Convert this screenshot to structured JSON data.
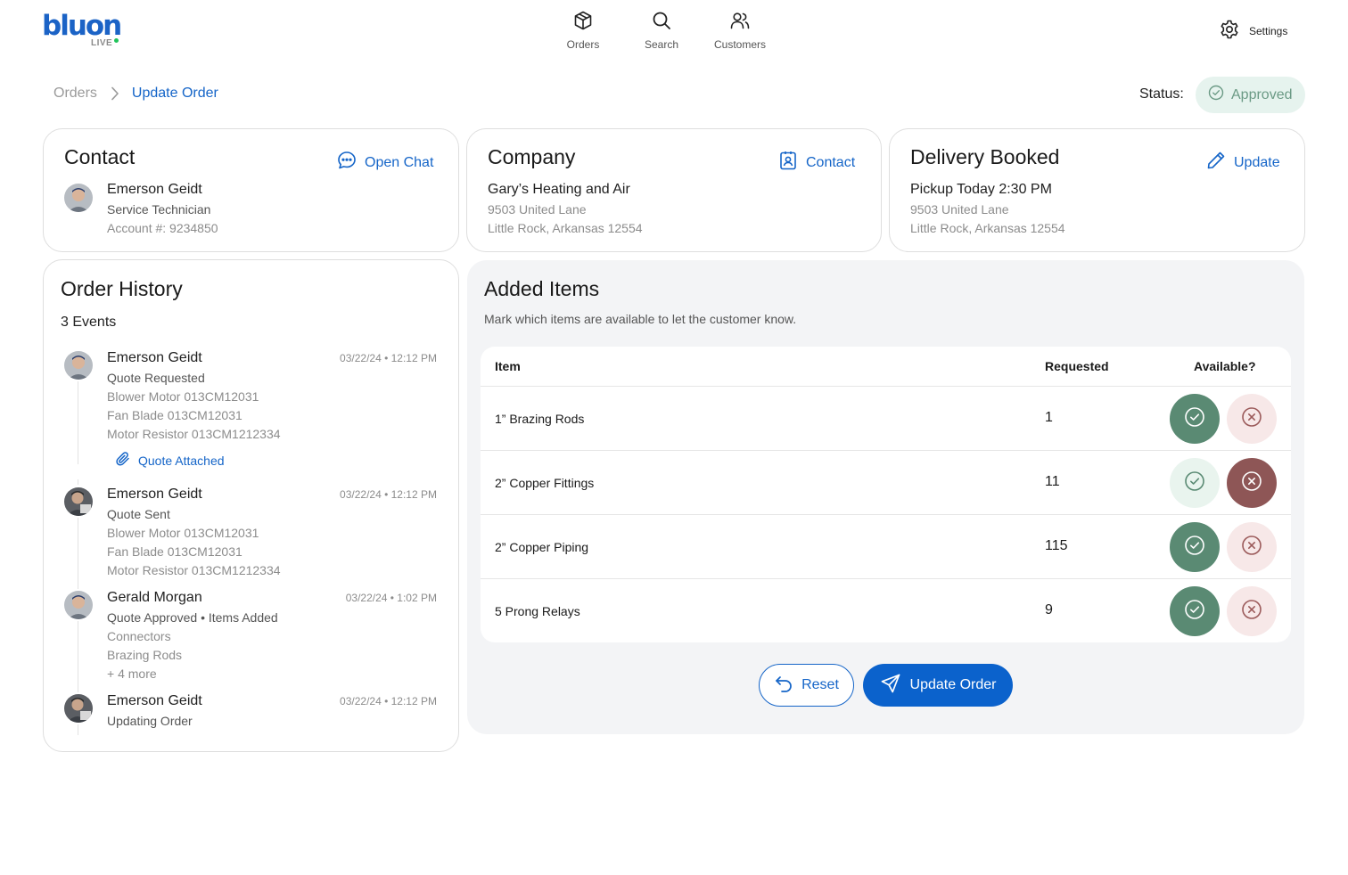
{
  "brand": {
    "logo_text": "bluon",
    "logo_sub": "LIVE"
  },
  "nav": {
    "orders": "Orders",
    "search": "Search",
    "customers": "Customers",
    "settings": "Settings"
  },
  "breadcrumb": {
    "parent": "Orders",
    "current": "Update Order"
  },
  "status": {
    "label": "Status:",
    "value": "Approved"
  },
  "contact_card": {
    "title": "Contact",
    "action": "Open Chat",
    "name": "Emerson Geidt",
    "role": "Service Technician",
    "account": "Account #: 9234850"
  },
  "company_card": {
    "title": "Company",
    "action": "Contact",
    "name": "Gary’s Heating and Air",
    "address1": "9503 United Lane",
    "address2": "Little Rock, Arkansas 12554"
  },
  "delivery_card": {
    "title": "Delivery Booked",
    "action": "Update",
    "pickup": "Pickup Today 2:30 PM",
    "address1": "9503 United Lane",
    "address2": "Little Rock, Arkansas 12554"
  },
  "history": {
    "title": "Order History",
    "count": "3 Events",
    "events": [
      {
        "name": "Emerson Geidt",
        "time": "03/22/24 • 12:12 PM",
        "action": "Quote Requested",
        "items": [
          "Blower Motor 013CM12031",
          "Fan Blade 013CM12031",
          "Motor Resistor 013CM1212334"
        ],
        "attachment": "Quote Attached"
      },
      {
        "name": "Emerson Geidt",
        "time": "03/22/24 • 12:12 PM",
        "action": "Quote Sent",
        "items": [
          "Blower Motor 013CM12031",
          "Fan Blade 013CM12031",
          "Motor Resistor 013CM1212334"
        ]
      },
      {
        "name": "Gerald Morgan",
        "time": "03/22/24 • 1:02 PM",
        "action": "Quote Approved • Items Added",
        "items": [
          "Connectors",
          "Brazing Rods",
          "+ 4 more"
        ]
      },
      {
        "name": "Emerson Geidt",
        "time": "03/22/24 • 12:12 PM",
        "action": "Updating Order",
        "items": []
      }
    ]
  },
  "added_items": {
    "title": "Added Items",
    "description": "Mark which items are available to let the customer know.",
    "columns": {
      "item": "Item",
      "requested": "Requested",
      "available": "Available?"
    },
    "rows": [
      {
        "item": "1” Brazing Rods",
        "requested": "1",
        "available": true
      },
      {
        "item": "2” Copper Fittings",
        "requested": "11",
        "available": false
      },
      {
        "item": "2” Copper Piping",
        "requested": "115",
        "available": true
      },
      {
        "item": "5 Prong Relays",
        "requested": "9",
        "available": true
      }
    ],
    "reset_label": "Reset",
    "update_label": "Update Order"
  },
  "colors": {
    "brand_blue": "#1b63c6",
    "primary_button": "#0b62cc",
    "available_on": "#5a8a73",
    "unavailable_on": "#8e5656",
    "status_bg": "#e6f3ee"
  }
}
